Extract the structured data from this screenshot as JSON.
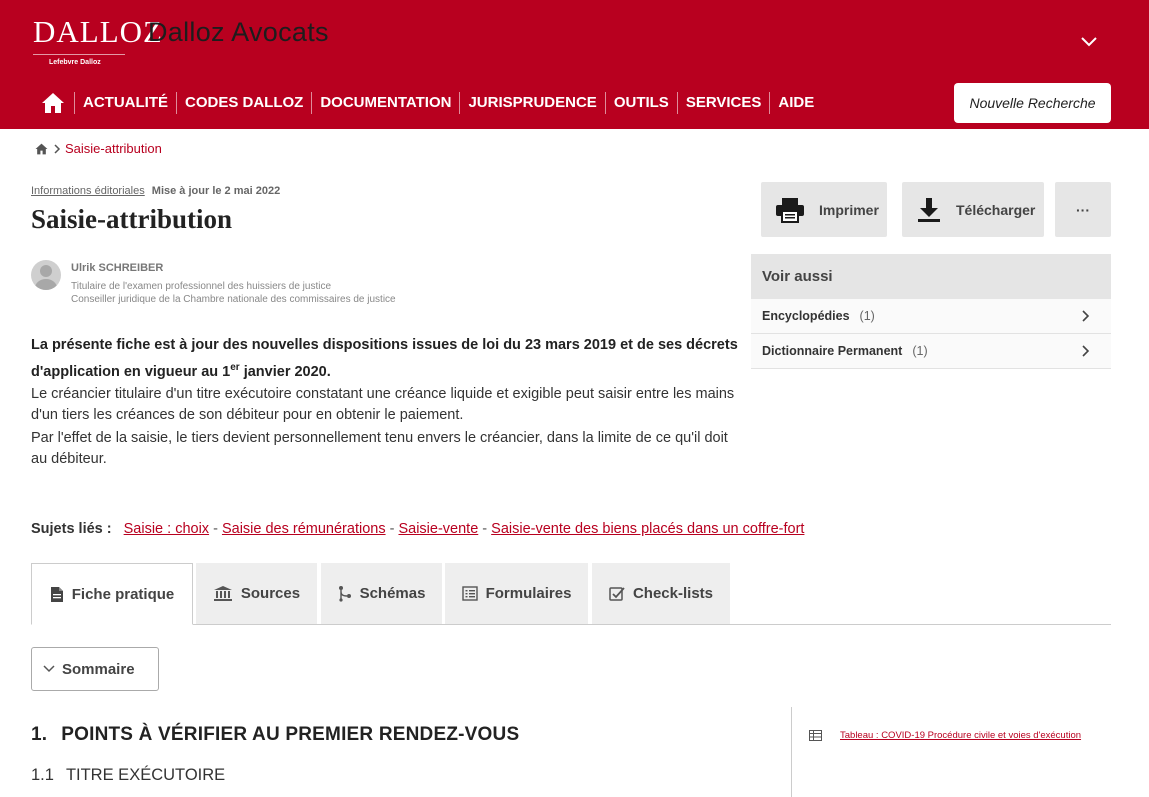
{
  "header": {
    "logo_text": "DALLOZ",
    "logo_sub": "Lefebvre Dalloz",
    "app_title": "Dalloz Avocats",
    "nav": [
      "ACTUALITÉ",
      "CODES DALLOZ",
      "DOCUMENTATION",
      "JURISPRUDENCE",
      "OUTILS",
      "SERVICES",
      "AIDE"
    ],
    "new_search_label": "Nouvelle Recherche"
  },
  "breadcrumb": {
    "current": "Saisie-attribution"
  },
  "meta": {
    "editorial_link": "Informations éditoriales",
    "updated": "Mise à jour le 2 mai 2022"
  },
  "page_title": "Saisie-attribution",
  "author": {
    "name": "Ulrik SCHREIBER",
    "roles": [
      "Titulaire de l'examen professionnel des huissiers de justice",
      "Conseiller juridique de la Chambre nationale des commissaires de justice"
    ]
  },
  "intro": {
    "bold_before": "La présente fiche est à jour des nouvelles dispositions issues de loi du 23 mars 2019 et de ses décrets d'application en vigueur au 1",
    "bold_sup": "er",
    "bold_after": " janvier 2020.",
    "paragraphs": [
      "Le créancier titulaire d'un titre exécutoire constatant une créance liquide et exigible peut saisir entre les mains d'un tiers les créances de son débiteur pour en obtenir le paiement.",
      "Par l'effet de la saisie, le tiers devient personnellement tenu envers le créancier, dans la limite de ce qu'il doit au débiteur."
    ]
  },
  "related": {
    "label": "Sujets liés :",
    "links": [
      "Saisie : choix",
      "Saisie des rémunérations",
      "Saisie-vente",
      "Saisie-vente des biens placés dans un coffre-fort"
    ],
    "separator": " - "
  },
  "tabs": [
    "Fiche pratique",
    "Sources",
    "Schémas",
    "Formulaires",
    "Check-lists"
  ],
  "sommaire_label": "Sommaire",
  "section": {
    "num": "1.",
    "title": "POINTS À VÉRIFIER AU PREMIER RENDEZ-VOUS"
  },
  "subsection": {
    "num": "1.1",
    "title": "TITRE EXÉCUTOIRE"
  },
  "side_link": "Tableau : COVID-19 Procédure civile et voies d'exécution",
  "actions": {
    "print": "Imprimer",
    "download": "Télécharger",
    "more": "···"
  },
  "see_also": {
    "title": "Voir aussi",
    "items": [
      {
        "label": "Encyclopédies",
        "count": "(1)"
      },
      {
        "label": "Dictionnaire Permanent",
        "count": "(1)"
      }
    ]
  },
  "colors": {
    "brand": "#b8001f",
    "panel": "#e6e6e6"
  }
}
